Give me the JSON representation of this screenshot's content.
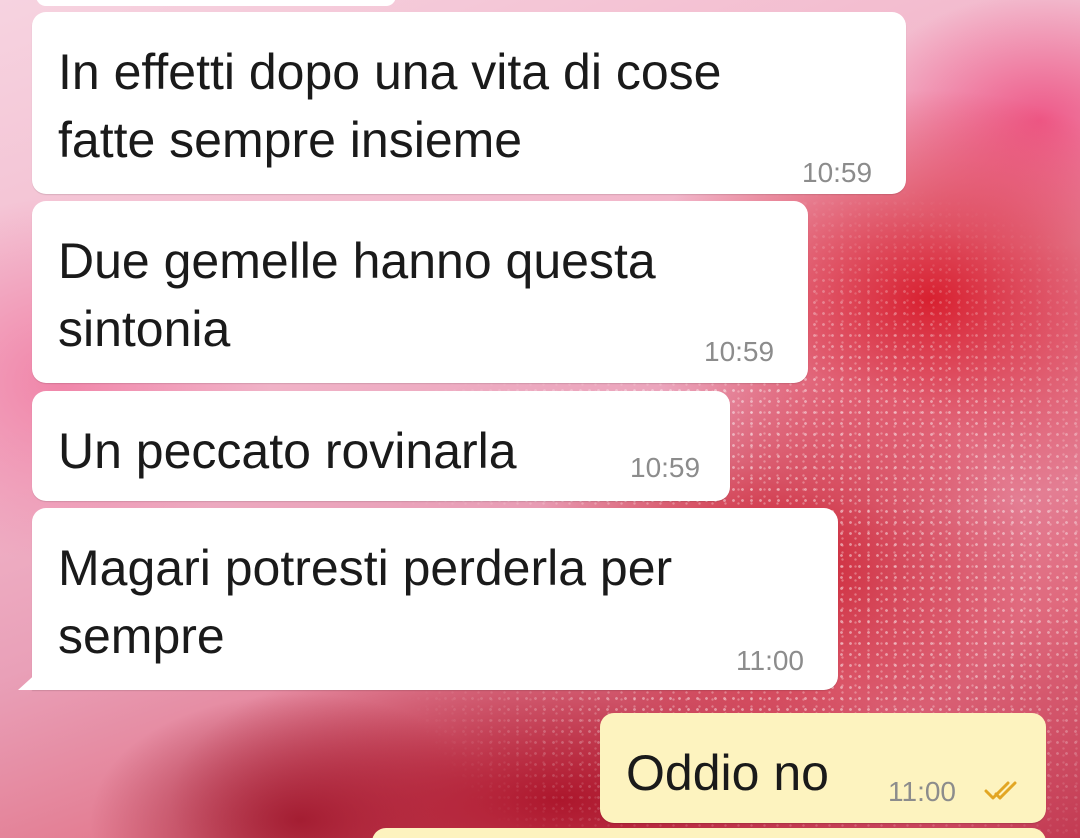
{
  "chat": {
    "messages": [
      {
        "direction": "incoming",
        "text": "In effetti dopo una vita di cose\nfatte sempre insieme",
        "time": "10:59"
      },
      {
        "direction": "incoming",
        "text": "Due gemelle hanno questa\nsintonia",
        "time": "10:59"
      },
      {
        "direction": "incoming",
        "text": "Un peccato rovinarla",
        "time": "10:59"
      },
      {
        "direction": "incoming",
        "text": "Magari potresti perderla per\nsempre",
        "time": "11:00"
      },
      {
        "direction": "outgoing",
        "text": "Oddio no",
        "time": "11:00",
        "status_icon": "double-check-icon"
      }
    ]
  },
  "colors": {
    "incoming_bubble": "#ffffff",
    "outgoing_bubble": "#fdf3bf",
    "timestamp": "#8c8c8c",
    "read_ticks": "#e2a623"
  }
}
